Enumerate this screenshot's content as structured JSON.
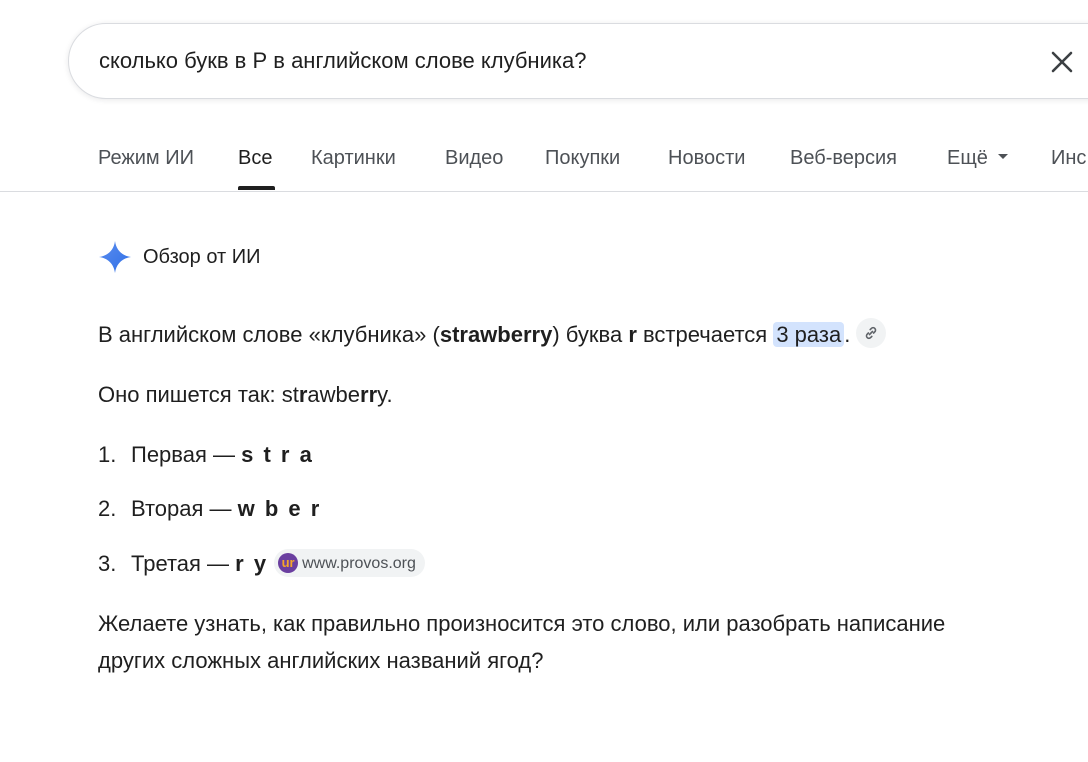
{
  "search": {
    "query": "сколько букв в Р в английском слове клубника?"
  },
  "tabs": [
    {
      "label": "Режим ИИ"
    },
    {
      "label": "Все"
    },
    {
      "label": "Картинки"
    },
    {
      "label": "Видео"
    },
    {
      "label": "Покупки"
    },
    {
      "label": "Новости"
    },
    {
      "label": "Веб-версия"
    },
    {
      "label": "Ещё"
    },
    {
      "label": "Инс"
    }
  ],
  "active_tab": "Все",
  "ai_overview": {
    "title": "Обзор от ИИ",
    "p1": {
      "a": "В английском слове «клубника» (",
      "word": "strawberry",
      "b": ") буква ",
      "letter": "r",
      "c": " встречается ",
      "highlight": "3 раза",
      "d": "."
    },
    "p2": {
      "a": "Оно пишется так: st",
      "r1": "r",
      "b": "awbe",
      "r2": "rr",
      "c": "y."
    },
    "list": [
      {
        "num": "1.",
        "text": "Первая — ",
        "letters": "s t r a"
      },
      {
        "num": "2.",
        "text": "Вторая — ",
        "letters": "w b e r"
      },
      {
        "num": "3.",
        "text": "Третая — ",
        "letters": "r y"
      }
    ],
    "source": {
      "logo_text": "ur",
      "label": "www.provos.org"
    },
    "p3_line1": "Желаете узнать, как правильно произносится это слово, или разобрать написание",
    "p3_line2": "других сложных английских названий ягод?"
  },
  "colors": {
    "sparkle": "#4285f4",
    "highlight": "#d3e3fd",
    "source_logo": "#6b3fa0"
  }
}
